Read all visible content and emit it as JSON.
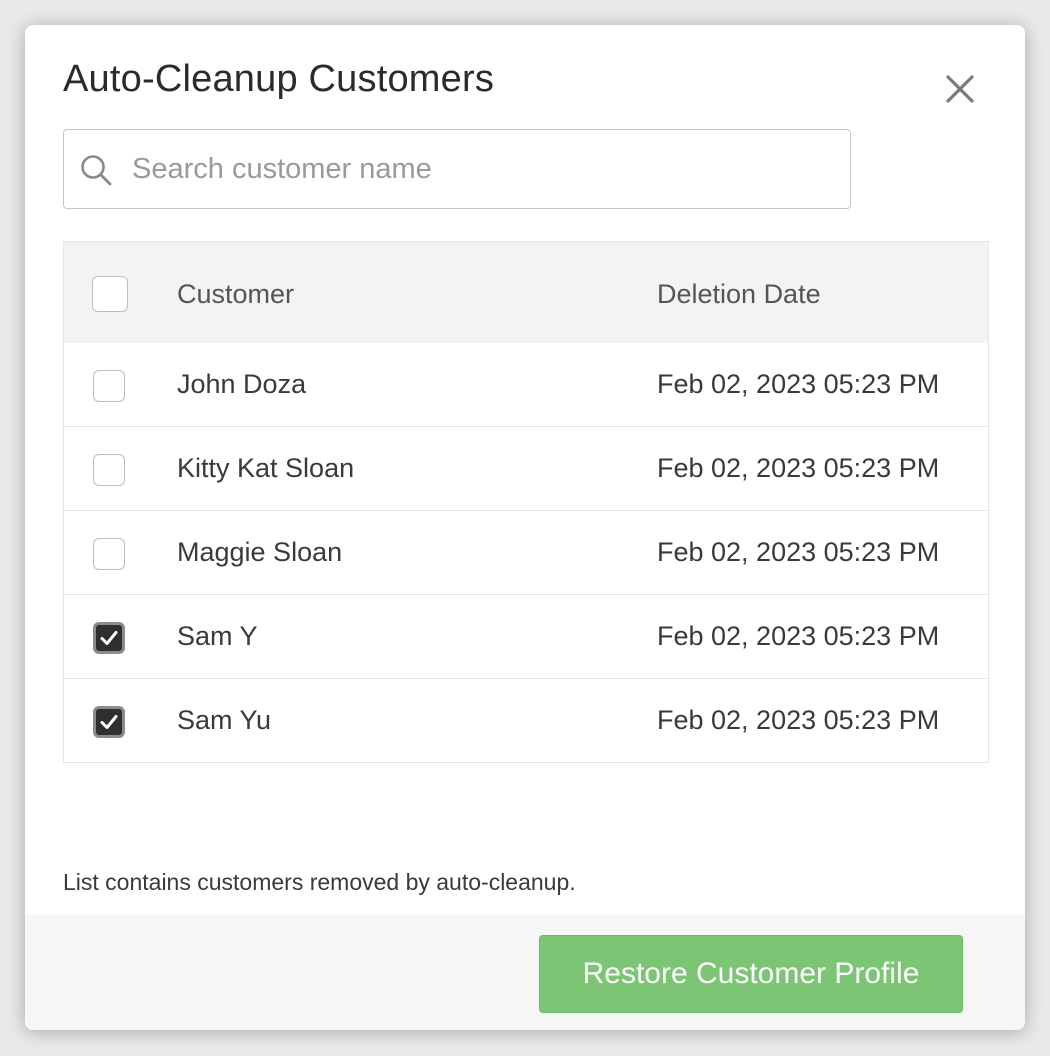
{
  "dialog": {
    "title": "Auto-Cleanup Customers"
  },
  "search": {
    "placeholder": "Search customer name",
    "value": ""
  },
  "table": {
    "headers": {
      "customer": "Customer",
      "deletion_date": "Deletion Date"
    },
    "select_all_checked": false,
    "rows": [
      {
        "customer": "John Doza",
        "deletion_date": "Feb 02, 2023 05:23 PM",
        "checked": false
      },
      {
        "customer": "Kitty Kat Sloan",
        "deletion_date": "Feb 02, 2023 05:23 PM",
        "checked": false
      },
      {
        "customer": "Maggie Sloan",
        "deletion_date": "Feb 02, 2023 05:23 PM",
        "checked": false
      },
      {
        "customer": "Sam Y",
        "deletion_date": "Feb 02, 2023 05:23 PM",
        "checked": true
      },
      {
        "customer": "Sam Yu",
        "deletion_date": "Feb 02, 2023 05:23 PM",
        "checked": true
      }
    ]
  },
  "footnote": "List contains customers removed by auto-cleanup.",
  "footer": {
    "restore_label": "Restore Customer Profile"
  },
  "colors": {
    "primary_button": "#7bc575",
    "checkbox_checked": "#2f2f2f",
    "header_bg": "#f3f3f2"
  },
  "icons": {
    "close": "close-icon",
    "search": "search-icon",
    "check": "check-icon"
  }
}
